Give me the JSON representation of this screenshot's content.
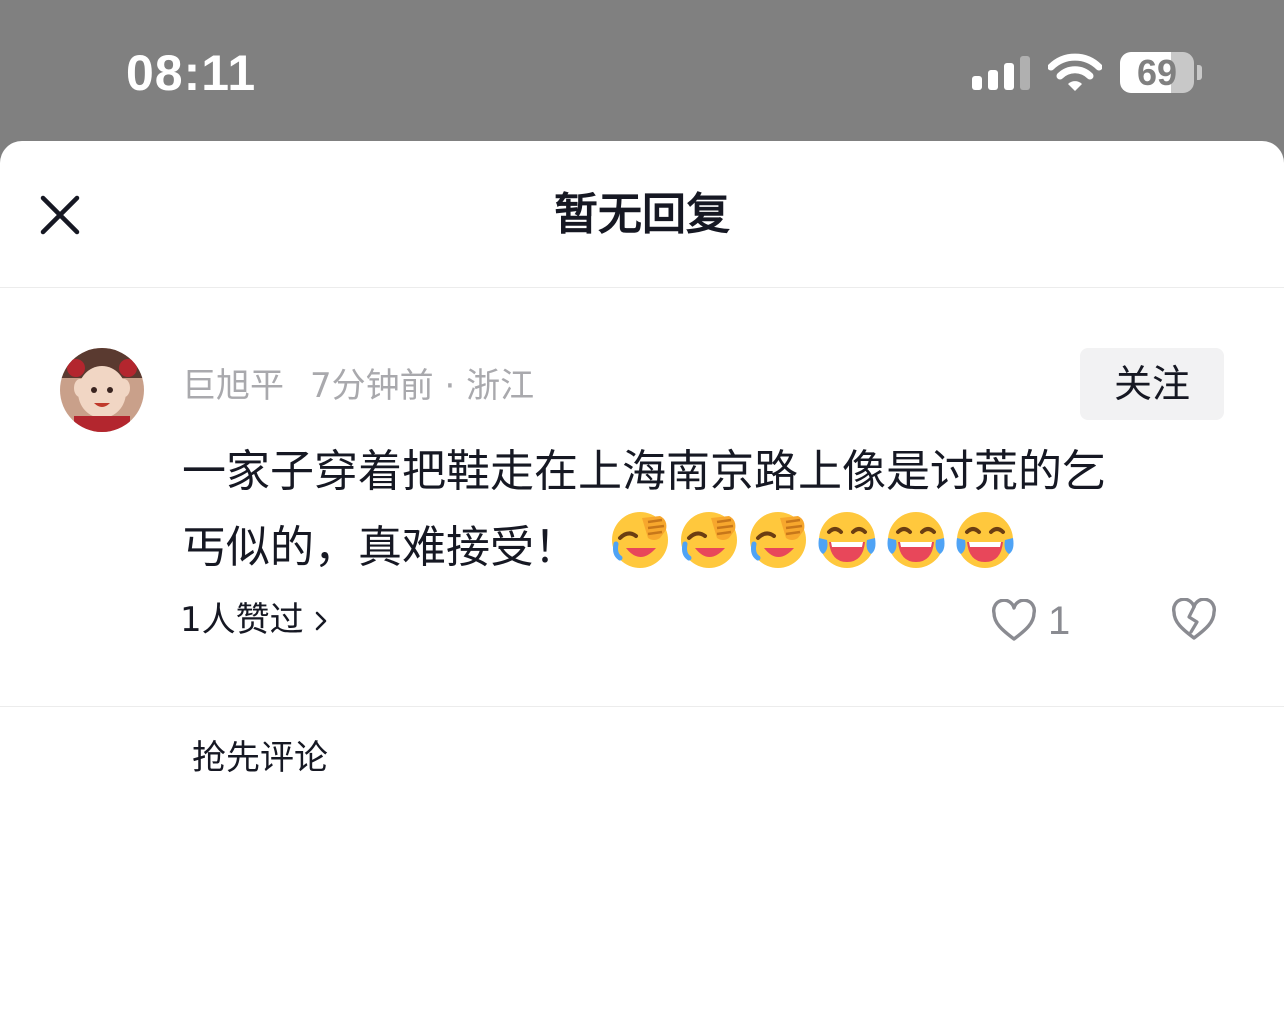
{
  "status_bar": {
    "time": "08:11",
    "battery_level": "69",
    "battery_fraction": 0.69,
    "signal_bars": 3,
    "signal_bars_total": 4
  },
  "header": {
    "title": "暂无回复",
    "close_icon": "close-icon"
  },
  "comment": {
    "author": "巨旭平",
    "time_ago": "7分钟前",
    "separator": "·",
    "location": "浙江",
    "follow_label": "关注",
    "text_line1": "一家子穿着把鞋走在上海南京路上像是讨荒的乞",
    "text_line2": "丐似的，真难接受！",
    "emojis": [
      "facepalm-laugh-emoji",
      "facepalm-laugh-emoji",
      "facepalm-laugh-emoji",
      "tears-of-joy-emoji",
      "tears-of-joy-emoji",
      "tears-of-joy-emoji"
    ],
    "liked_by": "1人赞过",
    "like_count": "1"
  },
  "footer": {
    "first_comment_label": "抢先评论"
  },
  "colors": {
    "overlay": "#808080",
    "text_primary": "#161823",
    "text_secondary": "#a9a9ad",
    "follow_bg": "#f2f2f3"
  }
}
